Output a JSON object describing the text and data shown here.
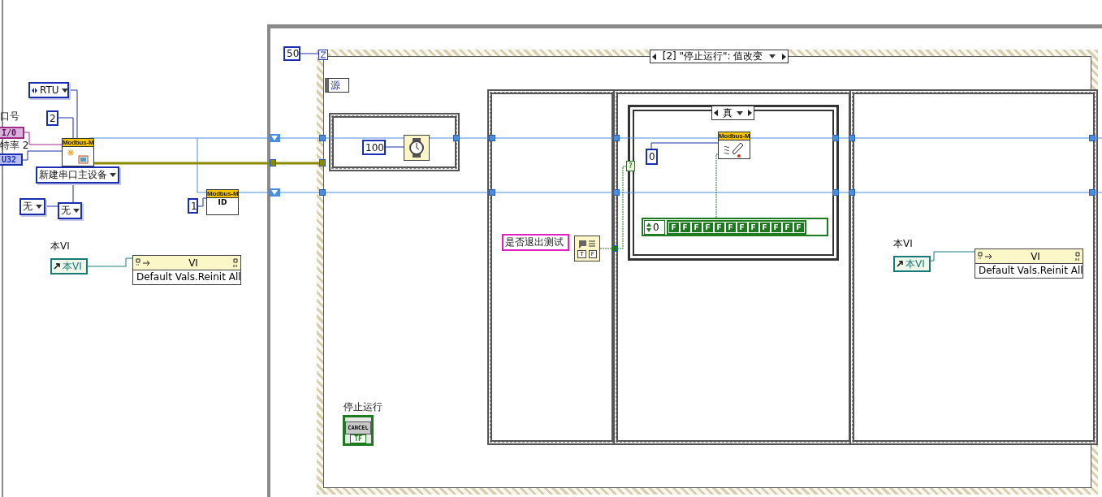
{
  "left_panel": {
    "port_label": "口号",
    "baud_label": "特率 2",
    "io_terminal": "I/0",
    "u32_terminal": "U32",
    "mode_ring": "RTU",
    "count_constant": "2",
    "create_node": {
      "badge": "Modbus-M"
    },
    "master_ring": "新建串口主设备",
    "parity_rings": [
      "无",
      "无"
    ],
    "id_constant": "1",
    "id_node": {
      "badge": "Modbus-M",
      "icon_text": "ID"
    },
    "vi_ref": {
      "label": "本VI",
      "value": "本VI"
    },
    "property_node": {
      "class": "VI",
      "property": "Default Vals.Reinit All"
    }
  },
  "event_structure": {
    "timeout": "50",
    "selector": "[2] \"停止运行\": 值改变",
    "source": "源",
    "wait_constant": "100",
    "frame_2": {
      "string_constant": "是否退出测试",
      "dialog_buttons": [
        "T",
        "F"
      ]
    },
    "case_structure": {
      "selector": "真",
      "selector_terminal": "?",
      "constant": "0",
      "write_node_badge": "Modbus-M",
      "array_index": "0",
      "array_values": [
        "F",
        "F",
        "F",
        "F",
        "F",
        "F",
        "F",
        "F",
        "F",
        "F",
        "F",
        "F"
      ]
    },
    "frame_3": {
      "vi_ref": {
        "label": "本VI",
        "value": "本VI"
      },
      "property_node": {
        "class": "VI",
        "property": "Default Vals.Reinit All"
      }
    },
    "stop_button": {
      "label": "停止运行",
      "caption": "CANCEL",
      "terminal": "TF"
    }
  }
}
